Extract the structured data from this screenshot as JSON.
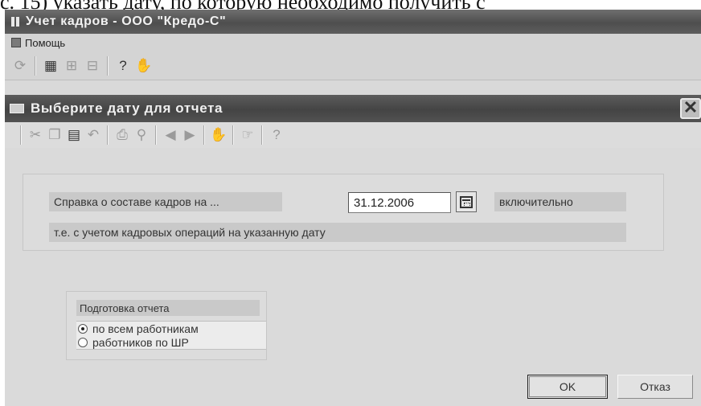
{
  "caption": "с. 15) указать дату, по которую необходимо получить с",
  "window": {
    "title": "Учет кадров - ООО \"Кредо-С\"",
    "menu": [
      {
        "label": "Помощь",
        "icon": "help-book-icon"
      }
    ],
    "toolbar": [
      {
        "icon": "refresh-icon",
        "glyph": "⟳"
      },
      {
        "icon": "table-icon",
        "glyph": "▦"
      },
      {
        "icon": "tree-icon",
        "glyph": "⊞"
      },
      {
        "icon": "tree-edit-icon",
        "glyph": "⊟"
      },
      {
        "icon": "help-icon",
        "glyph": "?"
      },
      {
        "icon": "exit-icon",
        "glyph": "✋"
      }
    ]
  },
  "dialog": {
    "title": "Выберите дату для отчета",
    "close_glyph": "✕",
    "toolbar": [
      {
        "icon": "cut-icon",
        "glyph": "✂",
        "dim": true
      },
      {
        "icon": "copy-icon",
        "glyph": "❐",
        "dim": true
      },
      {
        "icon": "paste-icon",
        "glyph": "▤",
        "dim": false
      },
      {
        "icon": "undo-icon",
        "glyph": "↶",
        "dim": true
      },
      {
        "icon": "print-icon",
        "glyph": "⎙",
        "dim": true
      },
      {
        "icon": "preview-icon",
        "glyph": "⚲",
        "dim": true
      },
      {
        "icon": "prev-icon",
        "glyph": "◀",
        "dim": true
      },
      {
        "icon": "next-icon",
        "glyph": "▶",
        "dim": true
      },
      {
        "icon": "hand-icon",
        "glyph": "✋",
        "dim": false
      },
      {
        "icon": "pointer-icon",
        "glyph": "☞",
        "dim": true
      },
      {
        "icon": "help-icon",
        "glyph": "?",
        "dim": true
      }
    ],
    "report_label": "Справка о составе кадров на ...",
    "date_value": "31.12.2006",
    "inclusive_label": "включительно",
    "note": "т.е. с учетом кадровых операций на указанную дату",
    "prep_title": "Подготовка отчета",
    "radio_options": [
      {
        "label": "по всем работникам",
        "checked": true
      },
      {
        "label": "работников по ШР",
        "checked": false
      }
    ],
    "ok_label": "OK",
    "cancel_label": "Отказ"
  }
}
